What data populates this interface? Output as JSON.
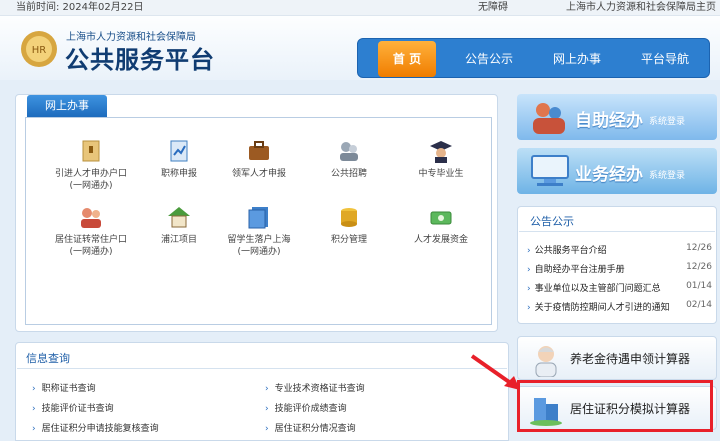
{
  "topbar": {
    "date_label": "当前时间: 2024年02月22日",
    "accessibility": "无障碍",
    "home_link": "上海市人力资源和社会保障局主页"
  },
  "header": {
    "org_name": "上海市人力资源和社会保障局",
    "platform_title": "公共服务平台",
    "logo_text": "HR"
  },
  "nav": [
    "首 页",
    "公告公示",
    "网上办事",
    "平台导航"
  ],
  "online": {
    "tab_label": "网上办事",
    "items": [
      {
        "label": "引进人才申办户口\n(一网通办)",
        "icon": "folder-icon"
      },
      {
        "label": "职称申报",
        "icon": "document-chart-icon"
      },
      {
        "label": "领军人才申报",
        "icon": "briefcase-icon"
      },
      {
        "label": "公共招聘",
        "icon": "people-icon"
      },
      {
        "label": "中专毕业生",
        "icon": "graduate-icon"
      },
      {
        "label": "居住证转常住户口\n(一网通办)",
        "icon": "family-icon"
      },
      {
        "label": "浦江项目",
        "icon": "house-icon"
      },
      {
        "label": "留学生落户上海\n(一网通办)",
        "icon": "passport-icon"
      },
      {
        "label": "积分管理",
        "icon": "coins-icon"
      },
      {
        "label": "人才发展资金",
        "icon": "money-icon"
      }
    ]
  },
  "query": {
    "title": "信息查询",
    "left": [
      "职称证书查询",
      "技能评价证书查询",
      "居住证积分申请技能复核查询"
    ],
    "right": [
      "专业技术资格证书查询",
      "技能评价成绩查询",
      "居住证积分情况查询"
    ]
  },
  "side": {
    "self_big": "自助经办",
    "self_small": "系统登录",
    "biz_big": "业务经办",
    "biz_small": "系统登录"
  },
  "notice": {
    "title": "公告公示",
    "items": [
      {
        "title": "公共服务平台介绍",
        "date": "12/26"
      },
      {
        "title": "自助经办平台注册手册",
        "date": "12/26"
      },
      {
        "title": "事业单位以及主管部门问题汇总",
        "date": "01/14"
      },
      {
        "title": "关于疫情防控期间人才引进的通知",
        "date": "02/14"
      }
    ]
  },
  "calculators": {
    "pension": "养老金待遇申领计算器",
    "residence": "居住证积分模拟计算器"
  },
  "colors": {
    "accent": "#2d7fd0",
    "active_nav": "#f07d00",
    "highlight": "#e8202a"
  }
}
